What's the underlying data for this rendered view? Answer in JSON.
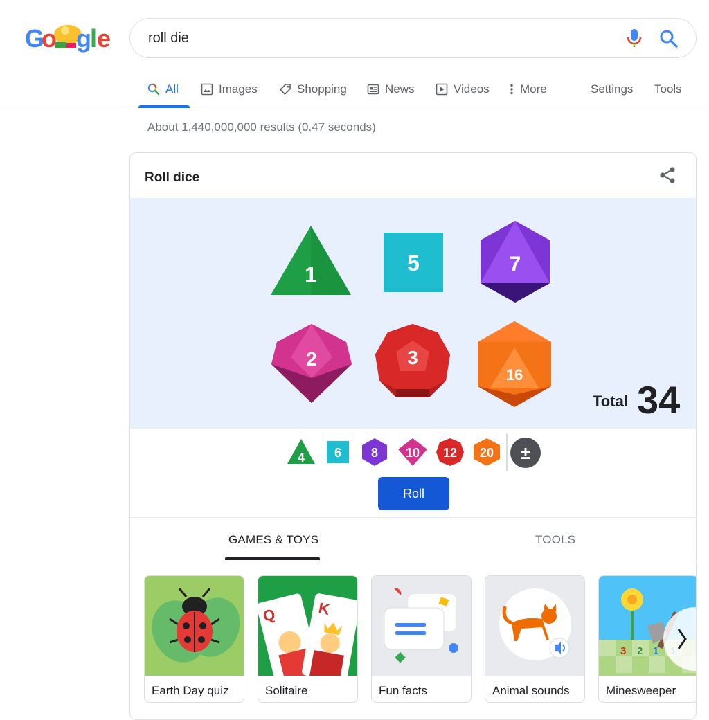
{
  "search": {
    "query": "roll die"
  },
  "tabs": [
    {
      "label": "All",
      "icon": "search-icon"
    },
    {
      "label": "Images",
      "icon": "image-icon"
    },
    {
      "label": "Shopping",
      "icon": "tag-icon"
    },
    {
      "label": "News",
      "icon": "news-icon"
    },
    {
      "label": "Videos",
      "icon": "play-icon"
    },
    {
      "label": "More",
      "icon": "more-vert-icon"
    },
    {
      "label": "Settings"
    },
    {
      "label": "Tools"
    }
  ],
  "result_stats": "About 1,440,000,000 results (0.47 seconds)",
  "card": {
    "title": "Roll dice",
    "dice": [
      {
        "type": "d4",
        "value": "1",
        "color": "#1e9e45"
      },
      {
        "type": "d6",
        "value": "5",
        "color": "#1fbdd0"
      },
      {
        "type": "d8",
        "value": "7",
        "color": "#7e35d6"
      },
      {
        "type": "d10",
        "value": "2",
        "color": "#d2338f"
      },
      {
        "type": "d12",
        "value": "3",
        "color": "#d92828"
      },
      {
        "type": "d20",
        "value": "16",
        "color": "#f47317"
      }
    ],
    "total_label": "Total",
    "total_value": "34",
    "die_buttons": [
      "4",
      "6",
      "8",
      "10",
      "12",
      "20",
      "±"
    ],
    "roll_label": "Roll",
    "tabs": [
      "GAMES & TOYS",
      "TOOLS"
    ],
    "games": [
      {
        "label": "Earth Day quiz",
        "icon": "ladybug-icon"
      },
      {
        "label": "Solitaire",
        "icon": "playing-cards-icon"
      },
      {
        "label": "Fun facts",
        "icon": "chat-bubbles-icon"
      },
      {
        "label": "Animal sounds",
        "icon": "cat-icon"
      },
      {
        "label": "Minesweeper",
        "icon": "minesweeper-icon"
      }
    ],
    "minesweeper_numbers": [
      "3",
      "2",
      "1",
      "1"
    ]
  }
}
